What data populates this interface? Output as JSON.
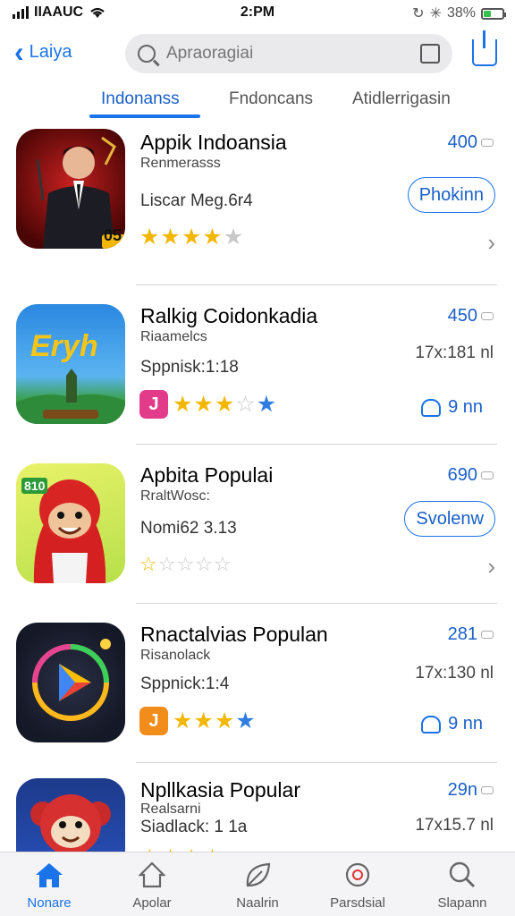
{
  "status": {
    "carrier": "IIAAUC",
    "time": "2:PM",
    "battery": "38%",
    "battery_level": 0.38
  },
  "header": {
    "back_label": "Laiya",
    "search_placeholder": "Apraoragiai"
  },
  "tabs": [
    {
      "label": "Indonanss",
      "active": true
    },
    {
      "label": "Fndoncans",
      "active": false
    },
    {
      "label": "Atidlerrigasin",
      "active": false
    }
  ],
  "apps": [
    {
      "title": "Appik Indoansia",
      "category": "Renmerasss",
      "meta": "Liscar Meg.6r4",
      "count": "400",
      "button": "Phokinn",
      "rating": 4,
      "icon": "businessman-app-icon",
      "icon_badge": "05"
    },
    {
      "title": "Ralkig Coidonkadia",
      "category": "Riaamelcs",
      "meta": "Sppnisk:1:18",
      "count": "450",
      "size": "17x:181 nl",
      "get_label": "9 nn",
      "rating": 3.5,
      "icon": "landscape-game-icon",
      "icon_text": "Eryh",
      "badge": "J",
      "badge_color": "#e23b8a"
    },
    {
      "title": "Apbita Populai",
      "category": "RraltWosc:",
      "meta": "Nomi62 3.13",
      "count": "690",
      "button": "Svolenw",
      "rating": 1,
      "icon": "red-character-icon",
      "icon_text": "810"
    },
    {
      "title": "Rnactalvias Populan",
      "category": "Risanolack",
      "meta": "Sppnick:1:4",
      "count": "281",
      "size": "17x:130 nl",
      "get_label": "9 nn",
      "rating": 3.5,
      "icon": "play-ring-icon",
      "badge": "J",
      "badge_color": "#f28c1a"
    },
    {
      "title": "Npllkasia Popular",
      "category": "Realsarni",
      "meta": "Siadlack: 1 1a",
      "count": "29n",
      "size": "17x15.7 nl",
      "rating": 4,
      "icon": "monkey-app-icon"
    }
  ],
  "tabbar": [
    {
      "label": "Nonare",
      "icon": "home-icon",
      "active": true
    },
    {
      "label": "Apolar",
      "icon": "apps-icon",
      "active": false
    },
    {
      "label": "Naalrin",
      "icon": "leaf-icon",
      "active": false
    },
    {
      "label": "Parsdsial",
      "icon": "target-icon",
      "active": false
    },
    {
      "label": "Slapann",
      "icon": "search-icon",
      "active": false
    }
  ],
  "colors": {
    "accent": "#1a73e8",
    "star": "#f2b705"
  }
}
